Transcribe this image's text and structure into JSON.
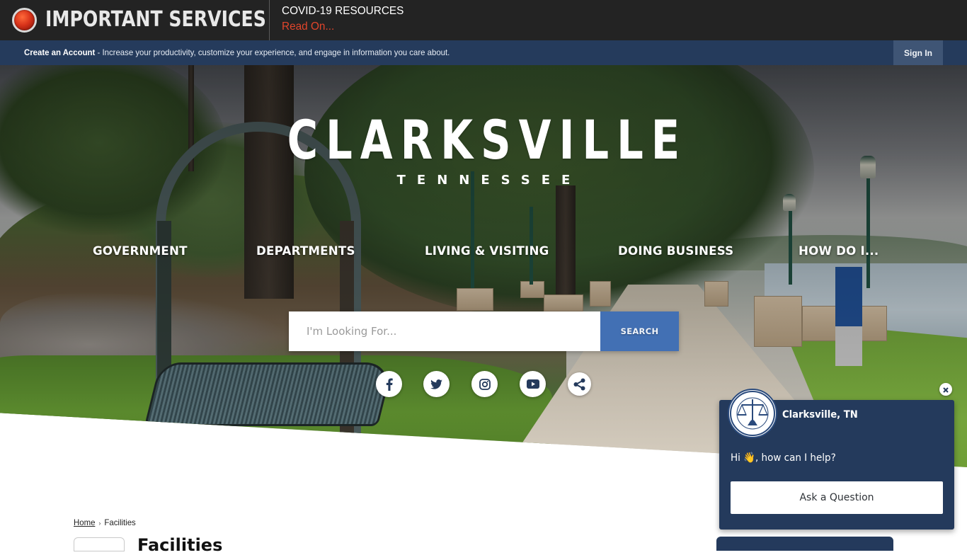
{
  "alert": {
    "title": "IMPORTANT SERVICES",
    "heading": "COVID-19 RESOURCES",
    "link": "Read On..."
  },
  "account_bar": {
    "create_account": "Create an Account",
    "message": " - Increase your productivity, customize your experience, and engage in information you care about.",
    "sign_in": "Sign In"
  },
  "logo": {
    "city": "CLARKSVILLE",
    "state": "TENNESSEE"
  },
  "nav": {
    "items": [
      {
        "label": "GOVERNMENT"
      },
      {
        "label": "DEPARTMENTS"
      },
      {
        "label": "LIVING & VISITING"
      },
      {
        "label": "DOING BUSINESS"
      },
      {
        "label": "HOW DO I..."
      }
    ]
  },
  "search": {
    "placeholder": "I'm Looking For...",
    "value": "",
    "button": "SEARCH"
  },
  "social": {
    "items": [
      {
        "icon": "facebook-icon"
      },
      {
        "icon": "twitter-icon"
      },
      {
        "icon": "instagram-icon"
      },
      {
        "icon": "youtube-icon"
      },
      {
        "icon": "share-icon"
      }
    ]
  },
  "breadcrumb": {
    "home": "Home",
    "separator": "›",
    "current": "Facilities"
  },
  "page": {
    "title": "Facilities"
  },
  "chat": {
    "name": "Clarksville, TN",
    "greeting": "Hi 👋, how can I help?",
    "ask_button": "Ask a Question",
    "seal_icon": "city-seal-icon"
  },
  "colors": {
    "alert_bg": "#232323",
    "alert_link": "#e2452b",
    "account_bar": "#253b5c",
    "search_button": "#4270b4",
    "chat_panel": "#243a5c"
  }
}
